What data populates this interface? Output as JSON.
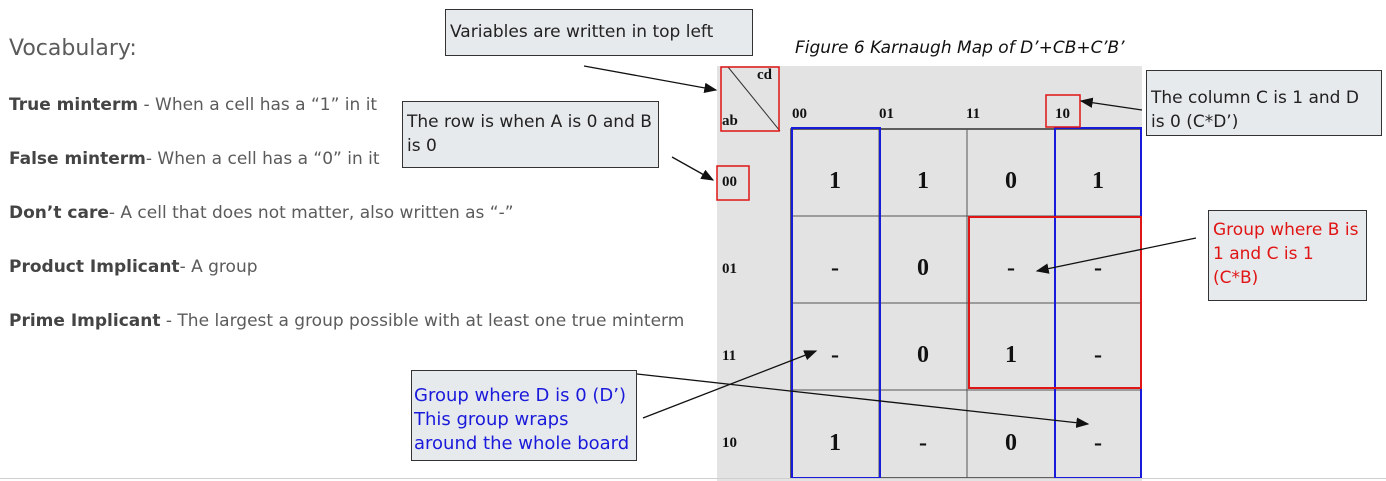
{
  "vocabulary": {
    "title": "Vocabulary:",
    "items": [
      {
        "term": "True minterm",
        "definition": " - When a cell has a “1” in it"
      },
      {
        "term": "False minterm",
        "definition": "- When a cell has a “0” in it"
      },
      {
        "term": "Don’t care",
        "definition": "- A cell that does not matter, also written as “-”"
      },
      {
        "term": "Product Implicant",
        "definition": "- A group"
      },
      {
        "term": "Prime Implicant",
        "definition": " - The largest a group possible with at least one true minterm"
      }
    ]
  },
  "figure": {
    "caption": "Figure 6 Karnaugh Map of D’+CB+C’B’",
    "corner_top": "cd",
    "corner_bottom": "ab",
    "col_headers": [
      "00",
      "01",
      "11",
      "10"
    ],
    "row_headers": [
      "00",
      "01",
      "11",
      "10"
    ],
    "cells": [
      [
        "1",
        "1",
        "0",
        "1"
      ],
      [
        "-",
        "0",
        "-",
        "-"
      ],
      [
        "-",
        "0",
        "1",
        "-"
      ],
      [
        "1",
        "-",
        "0",
        "-"
      ]
    ]
  },
  "callouts": {
    "variables": "Variables are written in top left",
    "row": "The row is when A is 0 and B is 0",
    "column": "The column C is 1 and D is 0 (C*D’)",
    "group_cb": "Group where B is 1 and C is 1 (C*B)",
    "group_d": "Group where D is 0 (D’) This group wraps around the whole board"
  },
  "colors": {
    "blue_group": "#1a1adb",
    "red_group": "#e01515",
    "callout_bg": "#e7eaec",
    "map_bg": "#e3e3e3"
  }
}
